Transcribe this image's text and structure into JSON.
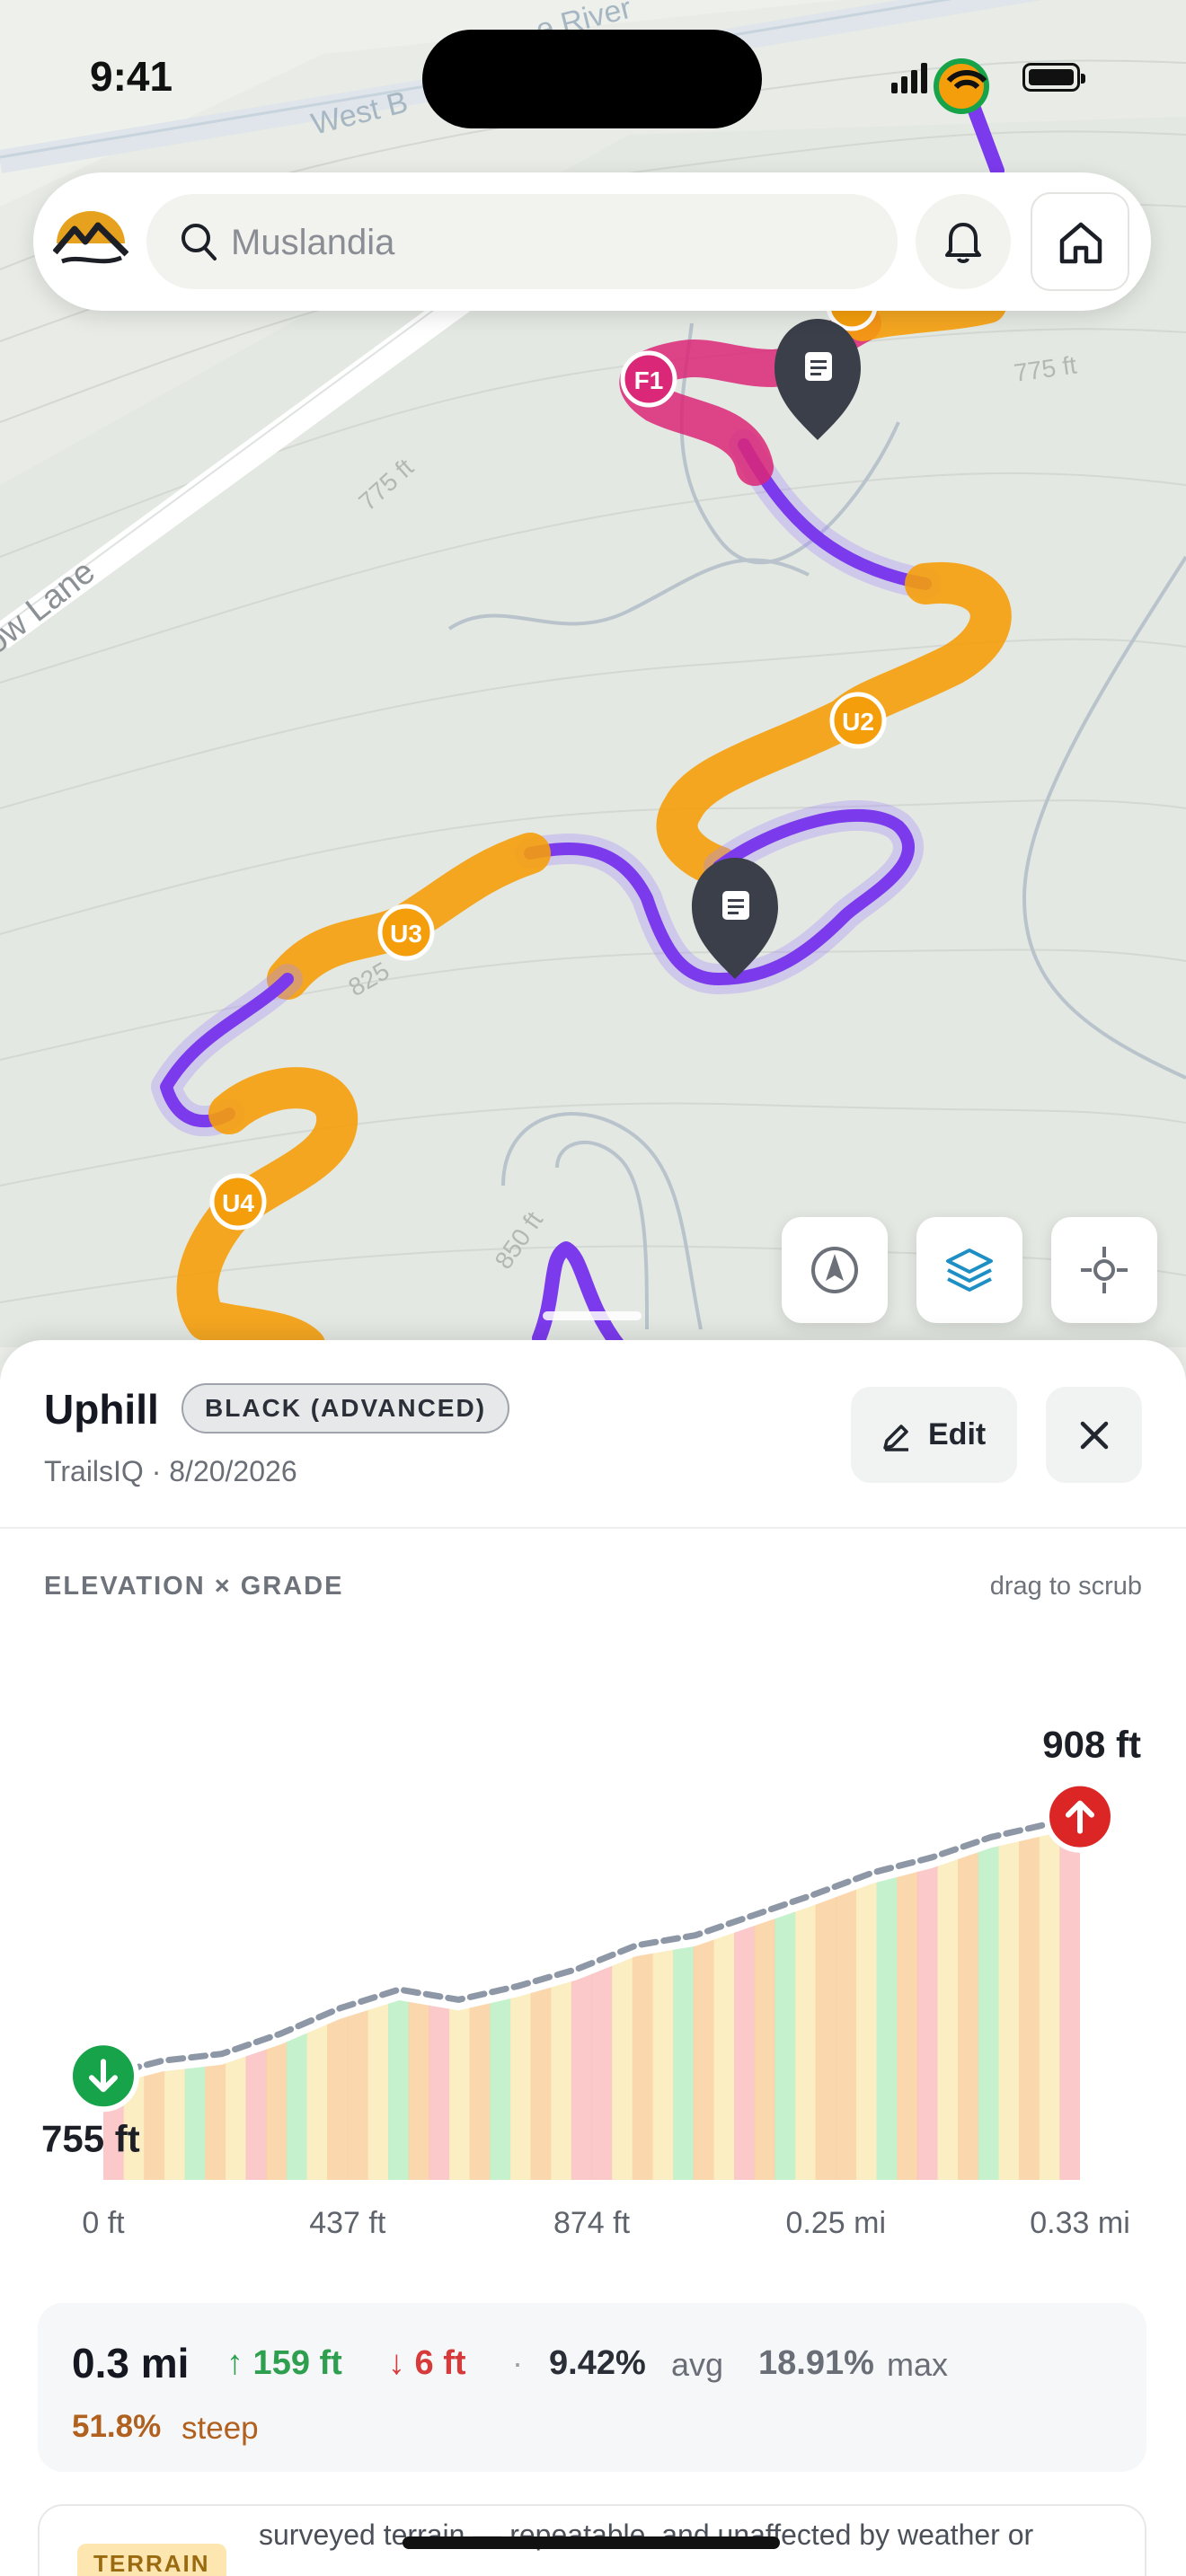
{
  "status_bar": {
    "time": "9:41"
  },
  "search": {
    "placeholder": "Muslandia"
  },
  "map": {
    "labels": {
      "river": "West B",
      "river2": "e River",
      "lane": "ow Lane",
      "contour_775_a": "775 ft",
      "contour_775_b": "775 ft",
      "contour_825": "825",
      "contour_850": "850 ft"
    },
    "markers": [
      "F1",
      "U2",
      "U3",
      "U4"
    ],
    "colors": {
      "purple": "#7c3aed",
      "orange": "#f59e0b",
      "magenta": "#db2777",
      "pin": "#3a3f4a"
    }
  },
  "sheet": {
    "title": "Uphill",
    "difficulty": "BLACK (ADVANCED)",
    "subtitle": "TrailsIQ · 8/20/2026",
    "edit_label": "Edit",
    "section_title": "ELEVATION × GRADE",
    "hint": "drag to scrub"
  },
  "chart_data": {
    "type": "area",
    "title": "ELEVATION × GRADE",
    "x_tick_labels": [
      "0 ft",
      "437 ft",
      "874 ft",
      "0.25 mi",
      "0.33 mi"
    ],
    "x_miles": [
      0,
      0.02,
      0.04,
      0.06,
      0.08,
      0.1,
      0.12,
      0.14,
      0.16,
      0.18,
      0.2,
      0.22,
      0.24,
      0.26,
      0.28,
      0.3,
      0.33
    ],
    "elevation_ft": [
      755,
      764,
      768,
      780,
      795,
      806,
      800,
      808,
      818,
      832,
      838,
      850,
      862,
      875,
      884,
      896,
      908
    ],
    "start_label": "755 ft",
    "end_label": "908 ft",
    "ylim": [
      700,
      920
    ],
    "xlim": [
      0,
      0.33
    ],
    "grade_colors": {
      "easy": "#bff0c6",
      "moderate": "#fbecbc",
      "steep": "#fbd3a4",
      "very_steep": "#fbc3c3"
    }
  },
  "stats": {
    "distance": "0.3 mi",
    "gain": "↑ 159 ft",
    "loss": "↓ 6 ft",
    "sep": "·",
    "avg_value": "9.42%",
    "avg_label": "avg",
    "max_value": "18.91%",
    "max_label": "max",
    "steep_value": "51.8%",
    "steep_label": "steep"
  },
  "terrain": {
    "tag": "TERRAIN",
    "text": "surveyed terrain — repeatable, and unaffected by weather or"
  }
}
